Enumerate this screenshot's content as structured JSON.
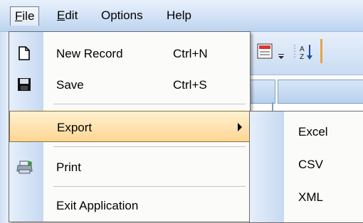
{
  "menubar": {
    "items": [
      {
        "label": "File",
        "mnemonic": "F",
        "rest": "ile"
      },
      {
        "label": "Edit",
        "mnemonic": "E",
        "rest": "dit"
      },
      {
        "label": "Options"
      },
      {
        "label": "Help"
      }
    ]
  },
  "file_menu": {
    "items": [
      {
        "label": "New Record",
        "shortcut": "Ctrl+N",
        "icon": "document-icon"
      },
      {
        "label": "Save",
        "shortcut": "Ctrl+S",
        "icon": "floppy-disk-icon"
      },
      {
        "label": "Export",
        "icon": "",
        "has_submenu": true,
        "highlighted": true
      },
      {
        "label": "Print",
        "icon": "printer-icon"
      },
      {
        "label": "Exit Application",
        "icon": ""
      }
    ]
  },
  "export_submenu": {
    "items": [
      {
        "label": "Excel"
      },
      {
        "label": "CSV"
      },
      {
        "label": "XML"
      }
    ]
  },
  "colors": {
    "highlight": "#ffd693",
    "gutter": "#c7d9f1",
    "menubar": "#cfe0f5"
  }
}
